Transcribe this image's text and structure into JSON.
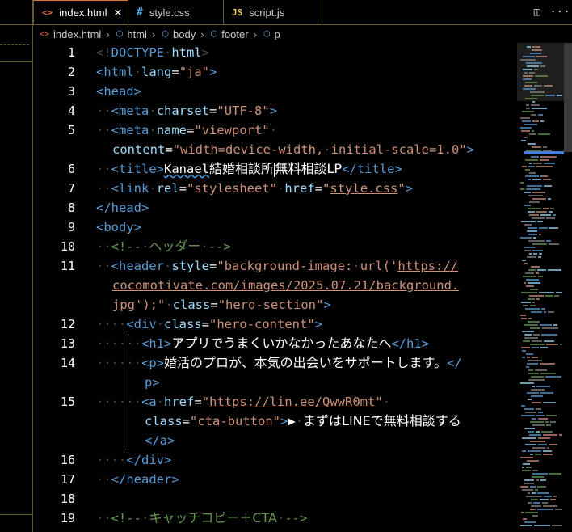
{
  "tabs": [
    {
      "icon": "<>",
      "label": "index.html",
      "close": "✕",
      "active": true
    },
    {
      "icon": "#",
      "label": "style.css",
      "active": false
    },
    {
      "icon": "JS",
      "label": "script.js",
      "active": false
    }
  ],
  "breadcrumb": [
    {
      "icon": "<>",
      "label": "index.html"
    },
    {
      "icon": "⬡",
      "label": "html"
    },
    {
      "icon": "⬡",
      "label": "body"
    },
    {
      "icon": "⬡",
      "label": "footer"
    },
    {
      "icon": "⬡",
      "label": "p"
    }
  ],
  "line_numbers": [
    "1",
    "2",
    "3",
    "4",
    "5",
    "6",
    "7",
    "8",
    "9",
    "10",
    "11",
    "12",
    "13",
    "14",
    "15",
    "16",
    "17",
    "18",
    "19"
  ],
  "code": {
    "l1": {
      "open": "<!",
      "kw": "DOCTYPE",
      "name": "html",
      "close": ">"
    },
    "l2": {
      "tag": "<html",
      "attr": "lang",
      "val": "\"ja\"",
      "close": ">"
    },
    "l3": {
      "tag": "<head>"
    },
    "l4": {
      "tag": "<meta",
      "attr": "charset",
      "val": "\"UTF-8\"",
      "close": ">"
    },
    "l5": {
      "tag": "<meta",
      "attr": "name",
      "val": "\"viewport\""
    },
    "l5b": {
      "attr": "content",
      "val": "\"width=device-width,",
      "val2": "initial-scale=1.0\"",
      "close": ">"
    },
    "l6": {
      "tag": "<title>",
      "brand": "Kanael",
      "text1": "結婚相談所",
      "text2": "無料相談LP",
      "close": "</title>"
    },
    "l7": {
      "tag": "<link",
      "attr1": "rel",
      "val1": "\"stylesheet\"",
      "attr2": "href",
      "val2a": "\"",
      "val2b": "style.css",
      "val2c": "\"",
      "close": ">"
    },
    "l8": {
      "tag": "</head>"
    },
    "l9": {
      "tag": "<body>"
    },
    "l10": {
      "comment": "<!--",
      "text": "ヘッダー",
      "end": "-->"
    },
    "l11": {
      "tag": "<header",
      "attr": "style",
      "val1": "\"background-image:",
      "val2": "url('",
      "url1": "https://"
    },
    "l11b": {
      "url2": "cocomotivate.com/images/2025.07.21/background."
    },
    "l11c": {
      "url3": "jpg",
      "val3": "');\"",
      "attr": "class",
      "val": "\"hero-section\"",
      "close": ">"
    },
    "l12": {
      "tag": "<div",
      "attr": "class",
      "val": "\"hero-content\"",
      "close": ">"
    },
    "l13": {
      "tag": "<h1>",
      "text": "アプリでうまくいかなかったあなたへ",
      "close": "</h1>"
    },
    "l14": {
      "tag": "<p>",
      "text": "婚活のプロが、本気の出会いをサポートします。",
      "close": "</"
    },
    "l14b": {
      "close": "p>"
    },
    "l15": {
      "tag": "<a",
      "attr": "href",
      "val1": "\"",
      "url": "https://lin.ee/QwwR0mt",
      "val2": "\""
    },
    "l15b": {
      "attr": "class",
      "val": "\"cta-button\"",
      "close": ">",
      "text1": "▶",
      "text2": "まずはLINEで無料相談する"
    },
    "l15c": {
      "close": "</a>"
    },
    "l16": {
      "tag": "</div>"
    },
    "l17": {
      "tag": "</header>"
    },
    "l19": {
      "comment": "<!--",
      "text": "キャッチコピー＋CTA",
      "end": "-->"
    }
  },
  "actions": [
    {
      "name": "split-editor",
      "glyph": "◫"
    },
    {
      "name": "more-actions",
      "glyph": "···"
    }
  ],
  "colors": {
    "tag": "#569cd6",
    "attr": "#9cdcfe",
    "string": "#ce9178",
    "comment": "#6a9955",
    "active_tab_accent": "#e07a2e"
  }
}
